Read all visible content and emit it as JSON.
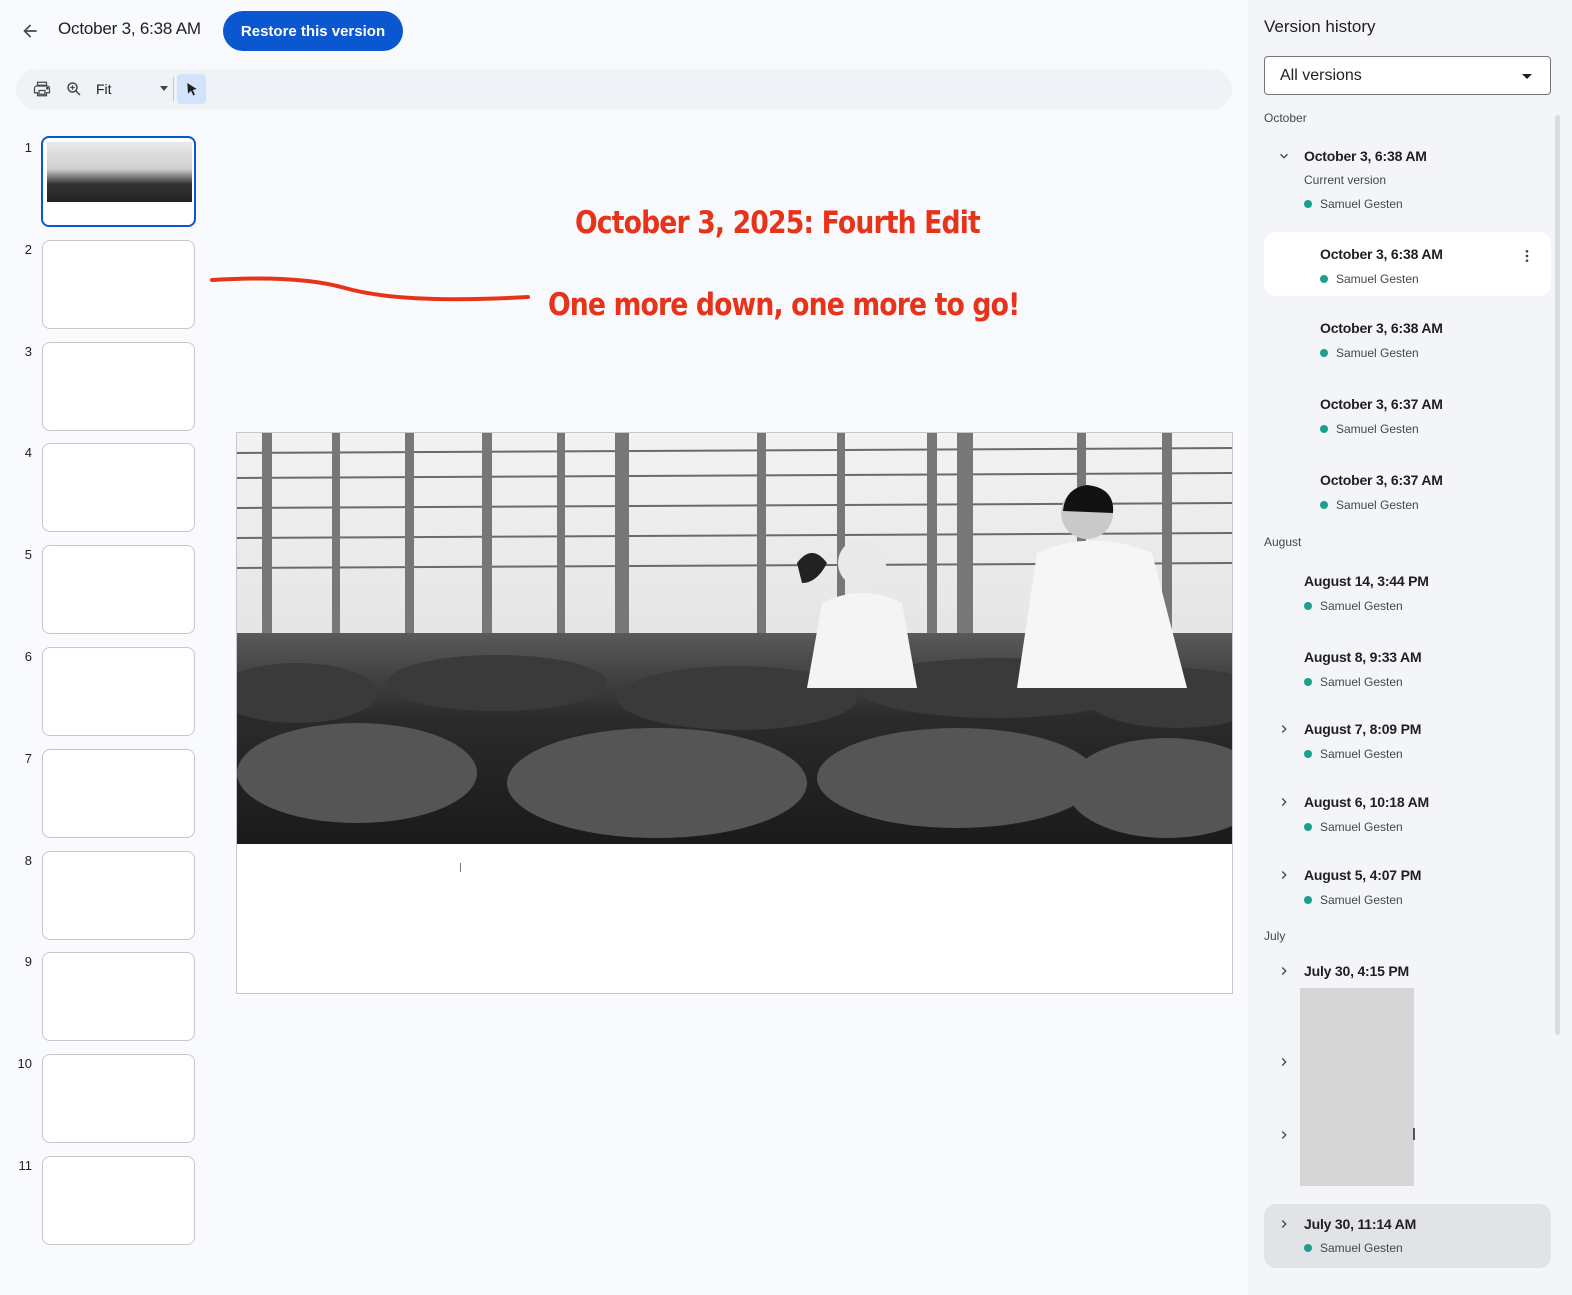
{
  "header": {
    "version_title": "October 3, 6:38 AM",
    "restore_label": "Restore this version"
  },
  "toolbar": {
    "zoom_value": "Fit",
    "icons": [
      "print-icon",
      "zoom-icon",
      "select-tool-icon"
    ]
  },
  "filmstrip": {
    "slides": [
      "1",
      "2",
      "3",
      "4",
      "5",
      "6",
      "7",
      "8",
      "9",
      "10",
      "11"
    ],
    "selected": "1"
  },
  "annotations": {
    "title": "October 3, 2025: Fourth Edit",
    "subtitle": "One more down, one more to go!",
    "color": "#e8331b"
  },
  "version_history": {
    "title": "Version history",
    "filter_value": "All versions",
    "months": {
      "october": "October",
      "august": "August",
      "july": "July"
    },
    "entries": [
      {
        "date": "October 3, 6:38 AM",
        "current": "Current version",
        "author": "Samuel Gesten"
      },
      {
        "date": "October 3, 6:38 AM",
        "author": "Samuel Gesten"
      },
      {
        "date": "October 3, 6:38 AM",
        "author": "Samuel Gesten"
      },
      {
        "date": "October 3, 6:37 AM",
        "author": "Samuel Gesten"
      },
      {
        "date": "October 3, 6:37 AM",
        "author": "Samuel Gesten"
      },
      {
        "date": "August 14, 3:44 PM",
        "author": "Samuel Gesten"
      },
      {
        "date": "August 8, 9:33 AM",
        "author": "Samuel Gesten"
      },
      {
        "date": "August 7, 8:09 PM",
        "author": "Samuel Gesten"
      },
      {
        "date": "August 6, 10:18 AM",
        "author": "Samuel Gesten"
      },
      {
        "date": "August 5, 4:07 PM",
        "author": "Samuel Gesten"
      },
      {
        "date": "July 30, 4:15 PM"
      },
      {
        "date": "July 30, 11:14 AM",
        "author": "Samuel Gesten"
      }
    ],
    "author_color": "#1e9e8c"
  },
  "colors": {
    "accent": "#0b57d0",
    "panel_bg": "#f3f5f9",
    "page_bg": "#f8fafd"
  }
}
